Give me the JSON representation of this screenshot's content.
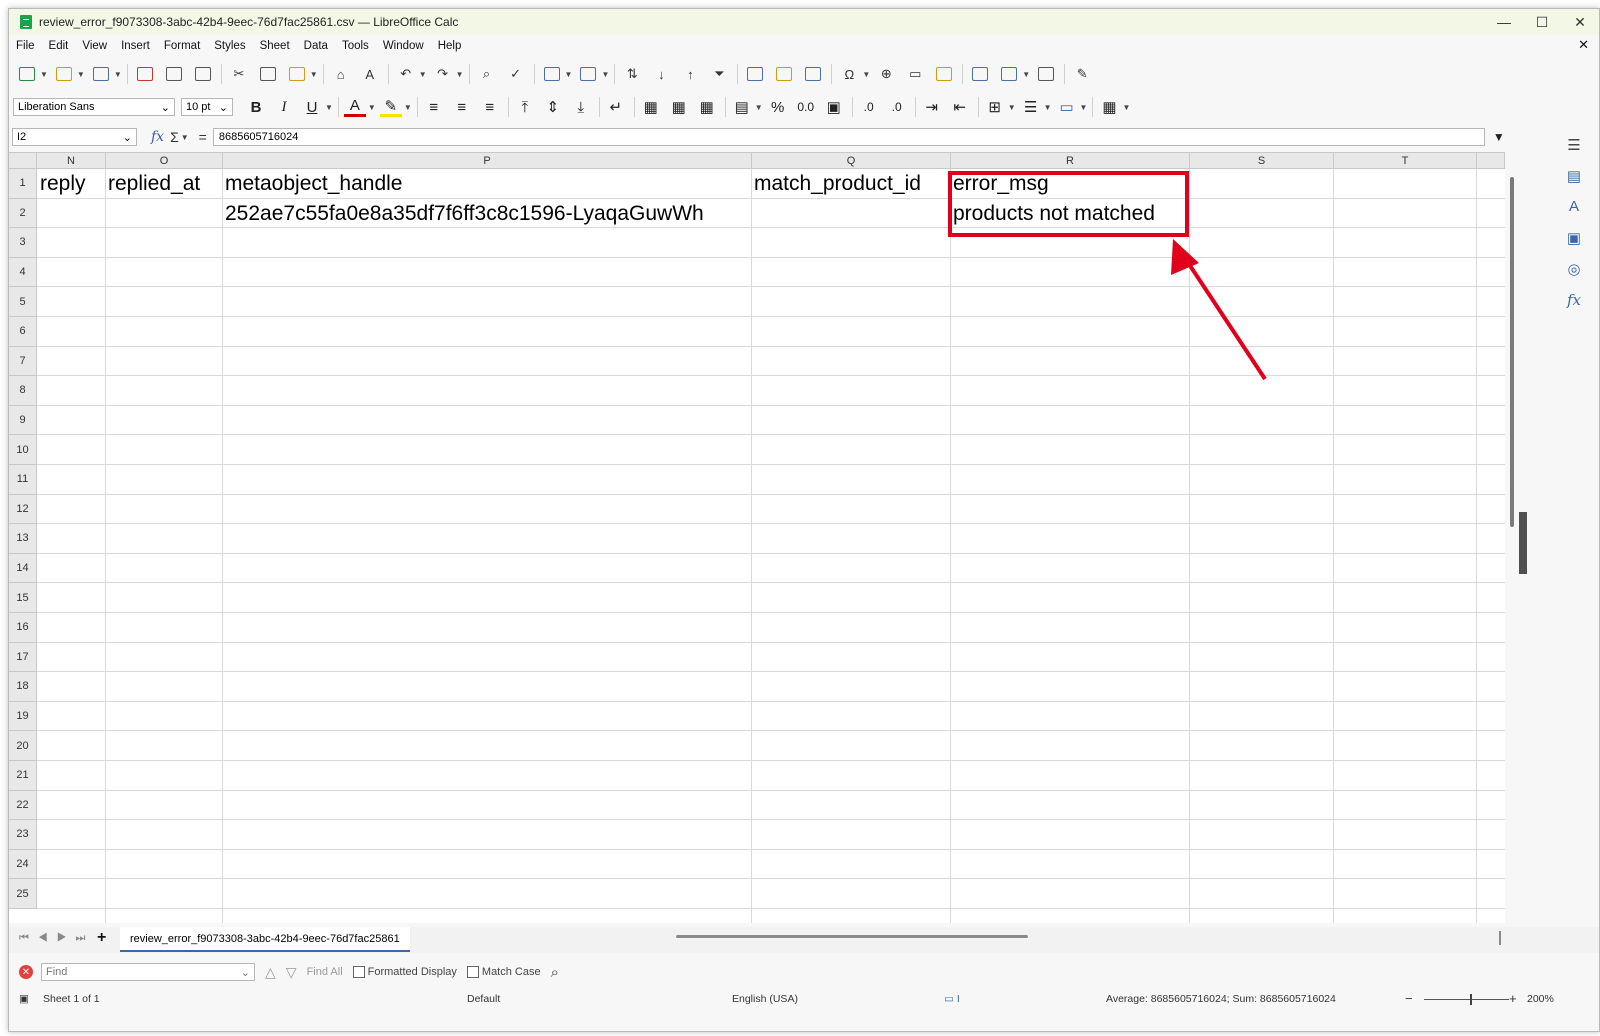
{
  "window": {
    "title": "review_error_f9073308-3abc-42b4-9eec-76d7fac25861.csv — LibreOffice Calc",
    "controls": {
      "minimize": "—",
      "maximize": "☐",
      "close": "✕"
    }
  },
  "menu": {
    "items": [
      "File",
      "Edit",
      "View",
      "Insert",
      "Format",
      "Styles",
      "Sheet",
      "Data",
      "Tools",
      "Window",
      "Help"
    ],
    "close_doc": "✕"
  },
  "format_toolbar": {
    "font_name": "Liberation Sans",
    "font_size": "10 pt",
    "bold": "B",
    "italic": "I",
    "underline": "U",
    "percent": "%",
    "number": "0.0"
  },
  "formula_bar": {
    "cell_ref": "I2",
    "fx": "fx",
    "sigma": "Σ",
    "equals": "=",
    "content": "8685605716024"
  },
  "columns": [
    {
      "label": "N"
    },
    {
      "label": "O"
    },
    {
      "label": "P"
    },
    {
      "label": "Q"
    },
    {
      "label": "R"
    },
    {
      "label": "S"
    },
    {
      "label": "T"
    }
  ],
  "rows": [
    "1",
    "2",
    "3",
    "4",
    "5",
    "6",
    "7",
    "8",
    "9",
    "10",
    "11",
    "12",
    "13",
    "14",
    "15",
    "16",
    "17",
    "18",
    "19",
    "20",
    "21",
    "22",
    "23",
    "24",
    "25"
  ],
  "cells": {
    "n1": "reply",
    "o1": "replied_at",
    "p1": "metaobject_handle",
    "q1": "match_product_id",
    "r1": "error_msg",
    "p2": "252ae7c55fa0e8a35df7f6ff3c8c1596-LyaqaGuwWh",
    "r2": "products not matched"
  },
  "annotation": {
    "color": "#e0001b"
  },
  "sheet_tabs": {
    "add": "+",
    "active_tab": "review_error_f9073308-3abc-42b4-9eec-76d7fac25861"
  },
  "find_bar": {
    "placeholder": "Find",
    "find_all": "Find All",
    "formatted_display": "Formatted Display",
    "match_case": "Match Case"
  },
  "status_bar": {
    "sheet": "Sheet 1 of 1",
    "page_style": "Default",
    "language": "English (USA)",
    "summary": "Average: 8685605716024; Sum: 8685605716024",
    "zoom": "200%",
    "zoom_minus": "−",
    "zoom_plus": "+"
  }
}
